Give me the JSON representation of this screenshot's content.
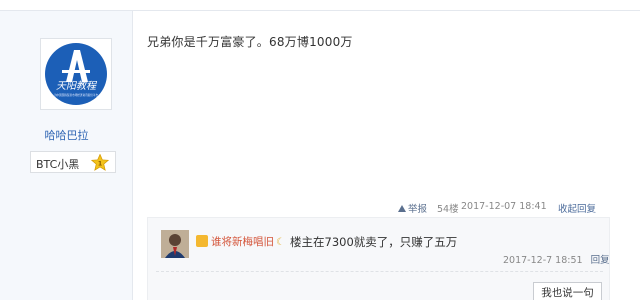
{
  "post": {
    "author": {
      "name": "哈哈巴拉",
      "avatar_alt_text": "天阳教程",
      "avatar_subtext": "为中国国际贸易市场经济资讯提供平台",
      "tag_label": "BTC小黑",
      "tag_badge_number": "1"
    },
    "content": "兄弟你是千万富豪了。68万博1000万",
    "footer": {
      "report_label": "举报",
      "floor": "54楼",
      "timestamp": "2017-12-07 18:41",
      "collapse_label": "收起回复"
    }
  },
  "reply": {
    "username": "谁将新梅唱旧",
    "text": "楼主在7300就卖了，只赚了五万",
    "timestamp": "2017-12-7 18:51",
    "reply_label": "回复",
    "say_button_label": "我也说一句"
  },
  "colors": {
    "sidebar_bg": "#f5f8fc",
    "link_blue": "#2d64b3",
    "username_red": "#d4553a",
    "logo_blue": "#1c5fb7"
  }
}
